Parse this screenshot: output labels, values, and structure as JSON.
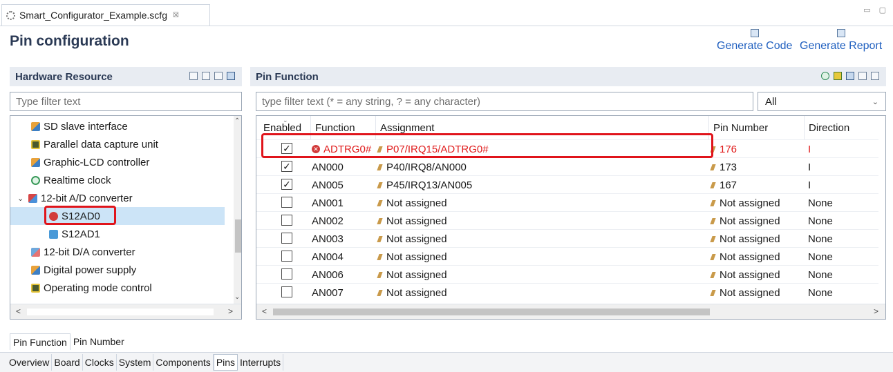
{
  "editor_tab": {
    "title": "Smart_Configurator_Example.scfg",
    "close": "☒"
  },
  "window_controls": {
    "minimize": "▭",
    "maximize": "▢"
  },
  "page_title": "Pin configuration",
  "actions": {
    "generate_code": "Generate Code",
    "generate_report": "Generate Report"
  },
  "hardware_resource": {
    "title": "Hardware Resource",
    "filter_placeholder": "Type filter text",
    "items": [
      {
        "label": "SD slave interface",
        "icon": "network-icon",
        "twisty": ""
      },
      {
        "label": "Parallel data capture unit",
        "icon": "chip-icon",
        "twisty": ""
      },
      {
        "label": "Graphic-LCD controller",
        "icon": "network-icon",
        "twisty": ""
      },
      {
        "label": "Realtime clock",
        "icon": "clock-icon",
        "twisty": ""
      },
      {
        "label": "12-bit A/D converter",
        "icon": "adc-icon",
        "twisty": "⌄"
      },
      {
        "label": "S12AD0",
        "icon": "error-icon",
        "twisty": ""
      },
      {
        "label": "S12AD1",
        "icon": "cube-icon",
        "twisty": ""
      },
      {
        "label": "12-bit D/A converter",
        "icon": "dac-icon",
        "twisty": ""
      },
      {
        "label": "Digital power supply",
        "icon": "network-icon",
        "twisty": ""
      },
      {
        "label": "Operating mode control",
        "icon": "chip-icon",
        "twisty": ""
      }
    ],
    "selected_index": 5
  },
  "pin_function": {
    "title": "Pin Function",
    "filter_placeholder": "type filter text (* = any string, ? = any character)",
    "filter_select": "All",
    "columns": [
      "Enabled",
      "Function",
      "Assignment",
      "Pin Number",
      "Direction"
    ],
    "rows": [
      {
        "enabled": true,
        "function": "ADTRG0#",
        "assignment": "P07/IRQ15/ADTRG0#",
        "pin_number": "176",
        "direction": "I",
        "error": true
      },
      {
        "enabled": true,
        "function": "AN000",
        "assignment": "P40/IRQ8/AN000",
        "pin_number": "173",
        "direction": "I",
        "error": false
      },
      {
        "enabled": true,
        "function": "AN005",
        "assignment": "P45/IRQ13/AN005",
        "pin_number": "167",
        "direction": "I",
        "error": false
      },
      {
        "enabled": false,
        "function": "AN001",
        "assignment": "Not assigned",
        "pin_number": "Not assigned",
        "direction": "None",
        "error": false
      },
      {
        "enabled": false,
        "function": "AN002",
        "assignment": "Not assigned",
        "pin_number": "Not assigned",
        "direction": "None",
        "error": false
      },
      {
        "enabled": false,
        "function": "AN003",
        "assignment": "Not assigned",
        "pin_number": "Not assigned",
        "direction": "None",
        "error": false
      },
      {
        "enabled": false,
        "function": "AN004",
        "assignment": "Not assigned",
        "pin_number": "Not assigned",
        "direction": "None",
        "error": false
      },
      {
        "enabled": false,
        "function": "AN006",
        "assignment": "Not assigned",
        "pin_number": "Not assigned",
        "direction": "None",
        "error": false
      },
      {
        "enabled": false,
        "function": "AN007",
        "assignment": "Not assigned",
        "pin_number": "Not assigned",
        "direction": "None",
        "error": false
      }
    ]
  },
  "bottom_tabs": [
    "Pin Function",
    "Pin Number"
  ],
  "page_tabs": [
    "Overview",
    "Board",
    "Clocks",
    "System",
    "Components",
    "Pins",
    "Interrupts"
  ],
  "active_page_tab": "Pins",
  "colors": {
    "error": "#e01b1b",
    "highlight": "#e0141b",
    "link": "#1f5fbf",
    "selection": "#cce4f7"
  }
}
